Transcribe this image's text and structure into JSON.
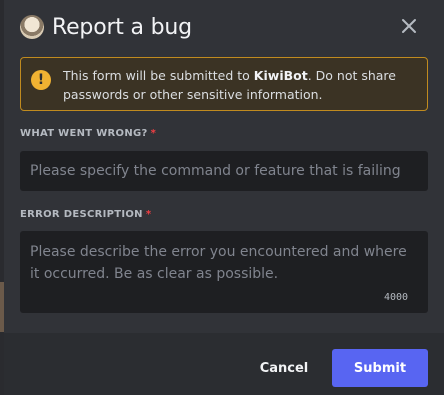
{
  "modal": {
    "title": "Report a bug"
  },
  "notice": {
    "prefix": "This form will be submitted to ",
    "bot_name": "KiwiBot",
    "suffix": ". Do not share passwords or other sensitive information."
  },
  "fields": {
    "what_went_wrong": {
      "label": "WHAT WENT WRONG?",
      "required_mark": "*",
      "value": "",
      "placeholder": "Please specify the command or feature that is failing"
    },
    "error_description": {
      "label": "ERROR DESCRIPTION",
      "required_mark": "*",
      "value": "",
      "placeholder": "Please describe the error you encountered and where it occurred. Be as clear as possible.",
      "char_limit": "4000"
    }
  },
  "footer": {
    "cancel_label": "Cancel",
    "submit_label": "Submit"
  },
  "icons": {
    "close": "close-icon",
    "warning": "warning-icon",
    "avatar": "avatar"
  },
  "colors": {
    "accent": "#5865f2",
    "warning": "#f0b232",
    "required": "#f23f43",
    "modal_bg": "#313338",
    "input_bg": "#1e1f22"
  }
}
